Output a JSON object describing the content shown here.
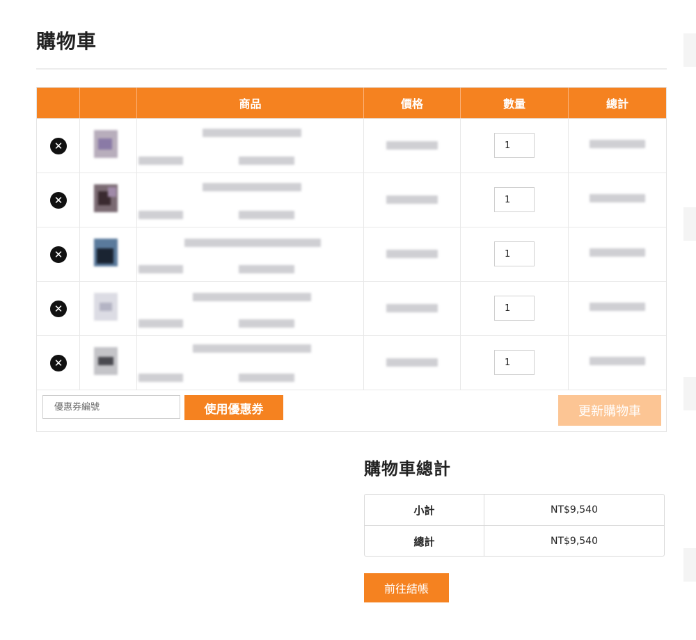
{
  "page": {
    "title": "購物車"
  },
  "cart": {
    "columns": {
      "remove": "",
      "thumbnail": "",
      "product": "商品",
      "price": "價格",
      "quantity": "數量",
      "subtotal": "總計"
    },
    "items": [
      {
        "quantity": "1"
      },
      {
        "quantity": "1"
      },
      {
        "quantity": "1"
      },
      {
        "quantity": "1"
      },
      {
        "quantity": "1"
      }
    ],
    "remove_glyph": "✕",
    "coupon_placeholder": "優惠券編號",
    "apply_coupon_label": "使用優惠券",
    "update_cart_label": "更新購物車"
  },
  "totals": {
    "title": "購物車總計",
    "subtotal_label": "小計",
    "subtotal_value": "NT$9,540",
    "total_label": "總計",
    "total_value": "NT$9,540"
  },
  "checkout": {
    "label": "前往結帳"
  },
  "colors": {
    "accent": "#f58220",
    "accent_light": "#fcc594",
    "border": "#e4e4e4"
  }
}
